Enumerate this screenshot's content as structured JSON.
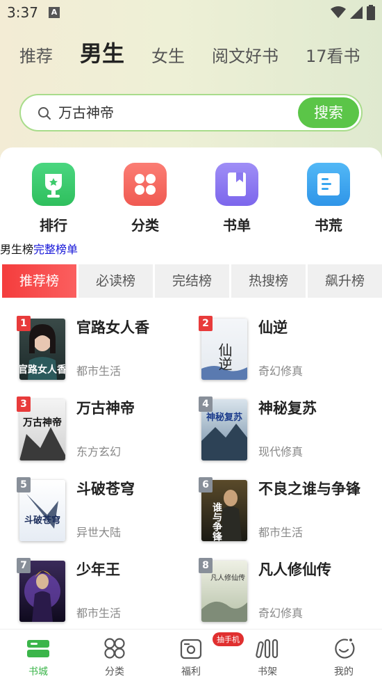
{
  "status_bar": {
    "time": "3:37",
    "notif_letter": "A"
  },
  "top_tabs": [
    {
      "label": "推荐"
    },
    {
      "label": "男生"
    },
    {
      "label": "女生"
    },
    {
      "label": "阅文好书"
    },
    {
      "label": "17看书"
    }
  ],
  "search": {
    "query": "万古神帝",
    "button": "搜索"
  },
  "quick": [
    {
      "label": "排行",
      "icon": "trophy-icon",
      "color": "#3dca6b"
    },
    {
      "label": "分类",
      "icon": "grid-icon",
      "color": "#f56b63"
    },
    {
      "label": "书单",
      "icon": "book-list-icon",
      "color": "#8a78f0"
    },
    {
      "label": "书荒",
      "icon": "open-book-icon",
      "color": "#3aa6f0"
    }
  ],
  "rank_header": {
    "title": "男生榜",
    "link": "完整榜单"
  },
  "rank_tabs": [
    "推荐榜",
    "必读榜",
    "完结榜",
    "热搜榜",
    "飙升榜"
  ],
  "books": [
    {
      "rank": "1",
      "title": "官路女人香",
      "category": "都市生活",
      "cover_text": "官路女人香"
    },
    {
      "rank": "2",
      "title": "仙逆",
      "category": "奇幻修真",
      "cover_text": "仙逆"
    },
    {
      "rank": "3",
      "title": "万古神帝",
      "category": "东方玄幻",
      "cover_text": "万古神帝"
    },
    {
      "rank": "4",
      "title": "神秘复苏",
      "category": "现代修真",
      "cover_text": "神秘复苏"
    },
    {
      "rank": "5",
      "title": "斗破苍穹",
      "category": "异世大陆",
      "cover_text": "斗破苍穹"
    },
    {
      "rank": "6",
      "title": "不良之谁与争锋",
      "category": "都市生活",
      "cover_text": "谁与争锋"
    },
    {
      "rank": "7",
      "title": "少年王",
      "category": "都市生活",
      "cover_text": ""
    },
    {
      "rank": "8",
      "title": "凡人修仙传",
      "category": "奇幻修真",
      "cover_text": "凡人修仙传"
    }
  ],
  "bottom_nav": [
    {
      "label": "书城",
      "icon": "bookstore-icon"
    },
    {
      "label": "分类",
      "icon": "category-icon"
    },
    {
      "label": "福利",
      "icon": "gift-icon",
      "badge": "抽手机"
    },
    {
      "label": "书架",
      "icon": "bookshelf-icon"
    },
    {
      "label": "我的",
      "icon": "profile-icon"
    }
  ],
  "colors": {
    "accent_green": "#5bc548",
    "rank_red": "#f43d3d"
  }
}
